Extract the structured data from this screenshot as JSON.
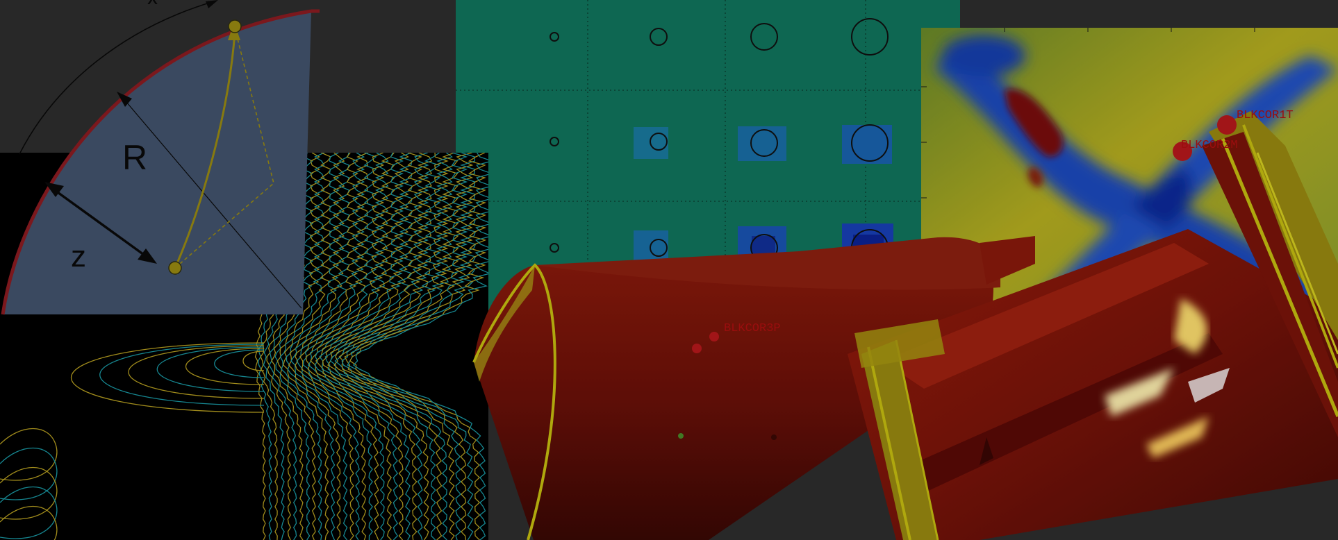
{
  "collage": {
    "geometry_diagram": {
      "labels": {
        "x": "x",
        "r": "R",
        "z": "z"
      },
      "colors": {
        "sector_fill": "#43546e",
        "rim": "#8c1c22",
        "guide": "#9a8b12"
      }
    },
    "contour_plot": {
      "colors": {
        "background": "#000000",
        "line_a": "#b8a020",
        "line_b": "#1a9aa6"
      }
    },
    "bubble_grid": {
      "colors": {
        "background": "#0f7a5c",
        "blob": "#1a3fa8",
        "circle": "#101010"
      }
    },
    "heatmap": {
      "colors": {
        "low": "#1030a0",
        "mid": "#c8c020",
        "high": "#7a0a0a"
      }
    },
    "scan_3d": {
      "markers": [
        {
          "label": "BLKCOR3P"
        },
        {
          "label": "BLKCOR1T"
        },
        {
          "label": "BLKCOR2M"
        }
      ],
      "colors": {
        "surface": "#7a1208",
        "edge": "#c8c010",
        "hot": "#ffe070",
        "marker": "#b8181c"
      }
    }
  }
}
